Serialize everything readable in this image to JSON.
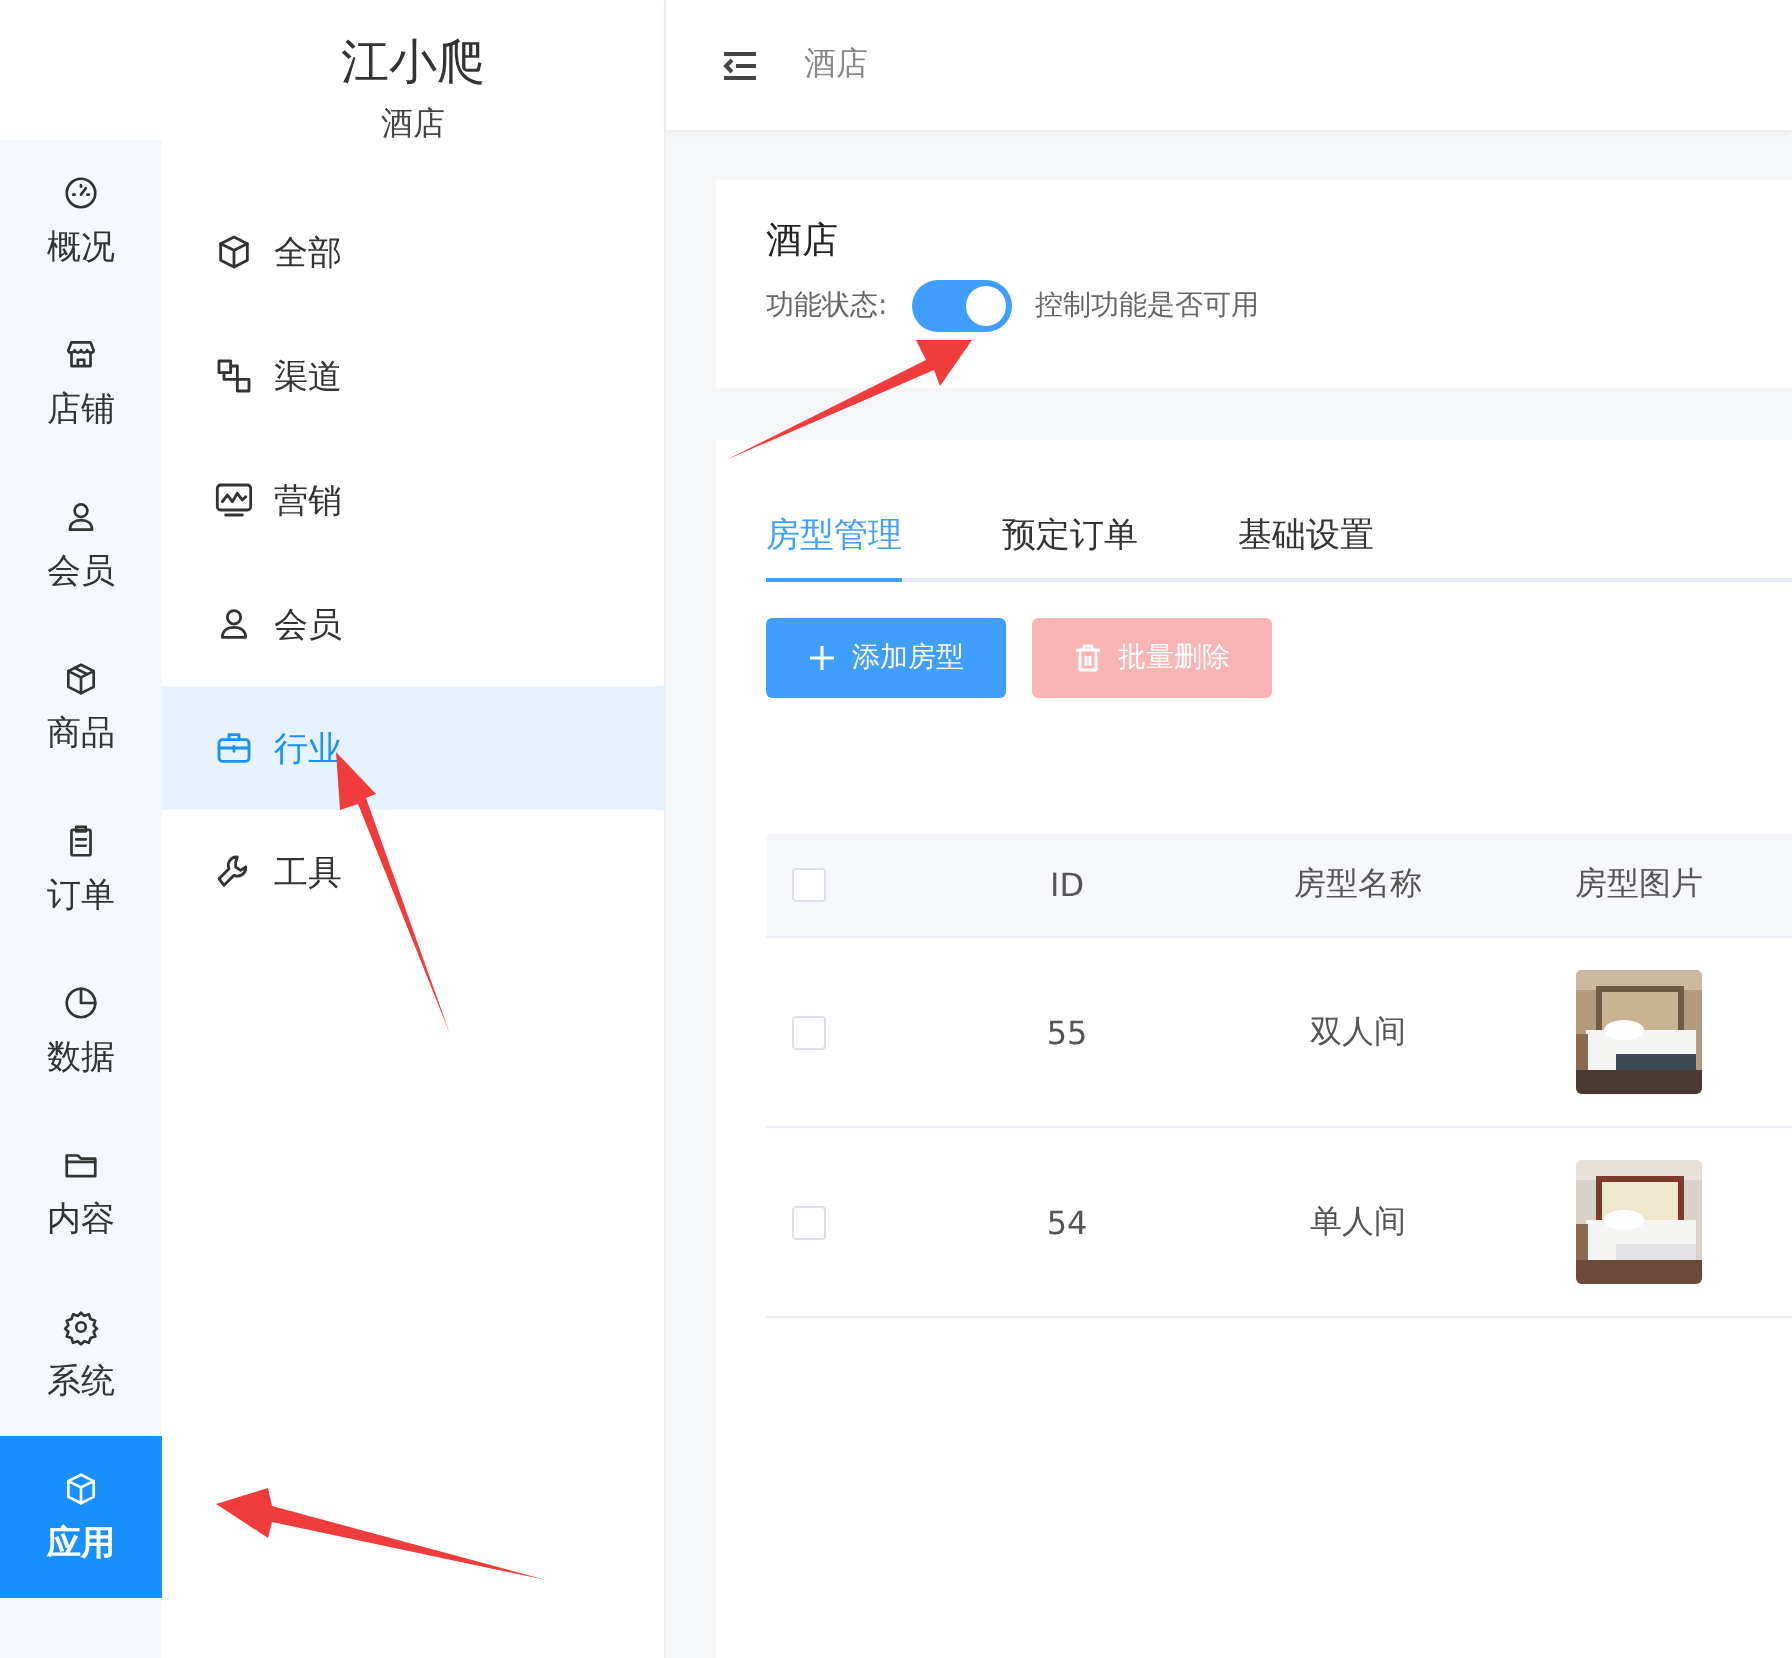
{
  "brand": {
    "name": "江小爬",
    "subtitle": "酒店"
  },
  "rail": [
    {
      "label": "概况",
      "selected": false
    },
    {
      "label": "店铺",
      "selected": false
    },
    {
      "label": "会员",
      "selected": false
    },
    {
      "label": "商品",
      "selected": false
    },
    {
      "label": "订单",
      "selected": false
    },
    {
      "label": "数据",
      "selected": false
    },
    {
      "label": "内容",
      "selected": false
    },
    {
      "label": "系统",
      "selected": false
    },
    {
      "label": "应用",
      "selected": true
    }
  ],
  "submenu": [
    {
      "label": "全部",
      "selected": false
    },
    {
      "label": "渠道",
      "selected": false
    },
    {
      "label": "营销",
      "selected": false
    },
    {
      "label": "会员",
      "selected": false
    },
    {
      "label": "行业",
      "selected": true
    },
    {
      "label": "工具",
      "selected": false
    }
  ],
  "breadcrumb": "酒店",
  "feature": {
    "title": "酒店",
    "status_label": "功能状态:",
    "on": true,
    "hint": "控制功能是否可用"
  },
  "tabs": [
    {
      "label": "房型管理",
      "selected": true
    },
    {
      "label": "预定订单",
      "selected": false
    },
    {
      "label": "基础设置",
      "selected": false
    }
  ],
  "actions": [
    {
      "label": "添加房型",
      "kind": "primary",
      "disabled": false
    },
    {
      "label": "批量删除",
      "kind": "danger",
      "disabled": true
    }
  ],
  "table": {
    "header_checked": false,
    "columns": [
      "ID",
      "房型名称",
      "房型图片"
    ],
    "rows": [
      {
        "checked": false,
        "id": "55",
        "name": "双人间"
      },
      {
        "checked": false,
        "id": "54",
        "name": "单人间"
      }
    ]
  }
}
